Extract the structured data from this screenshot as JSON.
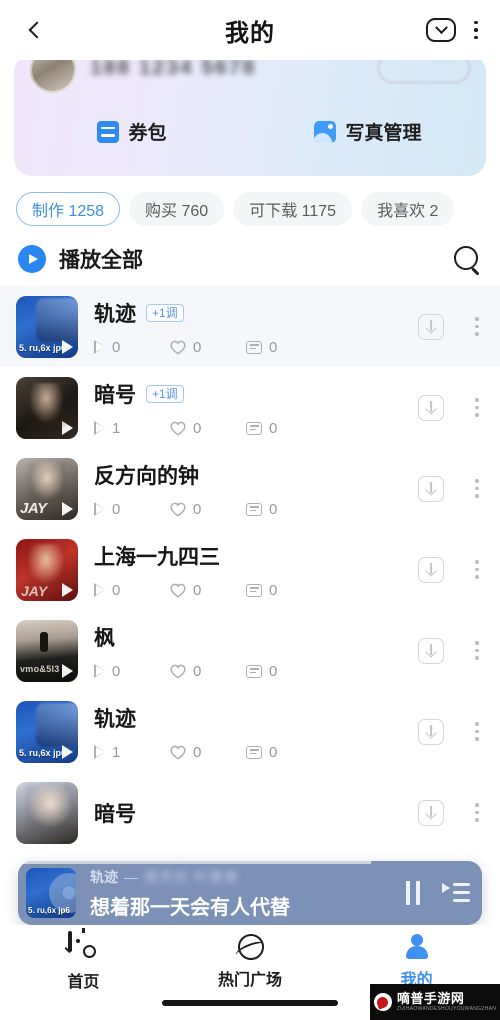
{
  "header": {
    "back_icon": "chevron-left-icon",
    "title": "我的",
    "message_icon": "message-icon",
    "menu_icon": "kebab-menu-icon"
  },
  "profile": {
    "name_masked": "188 1234 5678",
    "action_button": "",
    "links": [
      {
        "icon": "coupon-icon",
        "label": "券包"
      },
      {
        "icon": "photo-manage-icon",
        "label": "写真管理"
      }
    ]
  },
  "filters": [
    {
      "label": "制作 1258",
      "active": true
    },
    {
      "label": "购买 760",
      "active": false
    },
    {
      "label": "可下载 1175",
      "active": false
    },
    {
      "label": "我喜欢 2",
      "active": false
    }
  ],
  "play_all": {
    "label": "播放全部",
    "play_icon": "play-circle-icon",
    "search_icon": "search-icon"
  },
  "songs": [
    {
      "title": "轨迹",
      "key_badge": "+1调",
      "plays": "0",
      "likes": "0",
      "comments": "0",
      "cover": "cv-blue",
      "highlight": true
    },
    {
      "title": "暗号",
      "key_badge": "+1调",
      "plays": "1",
      "likes": "0",
      "comments": "0",
      "cover": "cv-dark1",
      "highlight": false
    },
    {
      "title": "反方向的钟",
      "key_badge": "",
      "plays": "0",
      "likes": "0",
      "comments": "0",
      "cover": "cv-grayface",
      "highlight": false
    },
    {
      "title": "上海一九四三",
      "key_badge": "",
      "plays": "0",
      "likes": "0",
      "comments": "0",
      "cover": "cv-red",
      "highlight": false
    },
    {
      "title": "枫",
      "key_badge": "",
      "plays": "0",
      "likes": "0",
      "comments": "0",
      "cover": "cv-scenic",
      "highlight": false
    },
    {
      "title": "轨迹",
      "key_badge": "",
      "plays": "1",
      "likes": "0",
      "comments": "0",
      "cover": "cv-blue",
      "highlight": false
    },
    {
      "title": "暗号",
      "key_badge": "",
      "plays": "",
      "likes": "",
      "comments": "",
      "cover": "cv-soft",
      "highlight": false
    }
  ],
  "player": {
    "song": "轨迹",
    "separator": "—",
    "artist_masked": "周杰伦 叶惠美",
    "lyric": "想着那一天会有人代替",
    "pause_icon": "pause-icon",
    "playlist_icon": "playlist-icon",
    "progress_percent": 76
  },
  "bottom_nav": [
    {
      "icon": "home-search-icon",
      "label": "首页",
      "active": false
    },
    {
      "icon": "planet-icon",
      "label": "热门广场",
      "active": false
    },
    {
      "icon": "person-icon",
      "label": "我的",
      "active": true
    }
  ],
  "watermark": {
    "main": "嘀普手游网",
    "sub": "ZUIHAOWANDESHOUYOUWANGZHAN"
  },
  "cover_art_text": {
    "line1": "vmo&5l3",
    "line2": "5. ru,6x jp6",
    "line3": "JAY"
  }
}
